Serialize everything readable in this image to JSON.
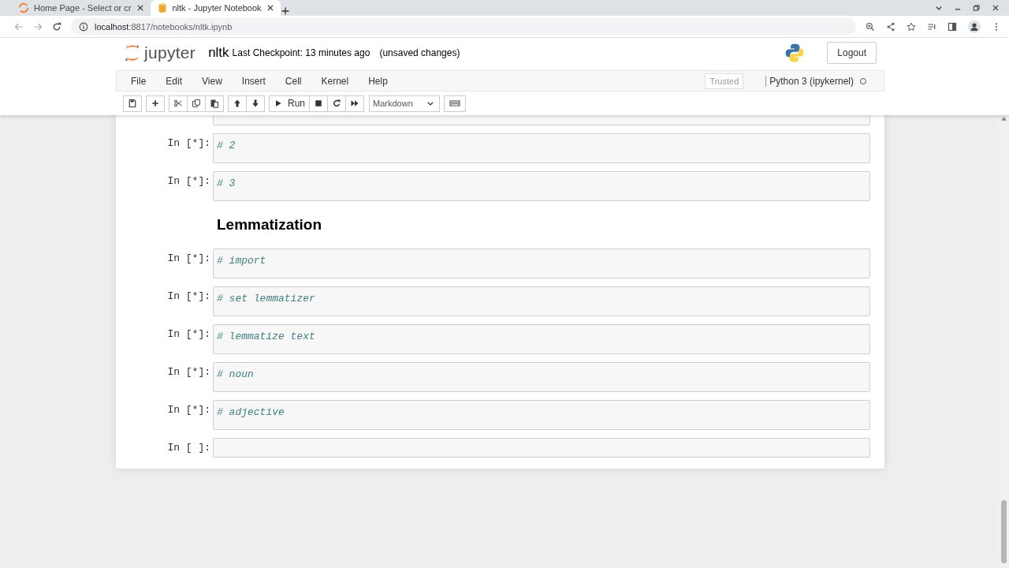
{
  "browser": {
    "tabs": [
      {
        "title": "Home Page - Select or cr",
        "selected": false
      },
      {
        "title": "nltk - Jupyter Notebook",
        "selected": true
      }
    ],
    "address": {
      "host": "localhost",
      "path": ":8817/notebooks/nltk.ipynb"
    }
  },
  "header": {
    "logo_text": "jupyter",
    "notebook_name": "nltk",
    "checkpoint": "Last Checkpoint: 13 minutes ago",
    "save_status": "(unsaved changes)",
    "logout": "Logout"
  },
  "menubar": {
    "items": [
      "File",
      "Edit",
      "View",
      "Insert",
      "Cell",
      "Kernel",
      "Help"
    ],
    "trusted": "Trusted",
    "kernel": "Python 3 (ipykernel)",
    "kernel_busy": false
  },
  "toolbar": {
    "groups": [
      [
        {
          "kind": "save"
        }
      ],
      [
        {
          "kind": "add"
        }
      ],
      [
        {
          "kind": "cut"
        },
        {
          "kind": "copy"
        },
        {
          "kind": "paste"
        }
      ],
      [
        {
          "kind": "up"
        },
        {
          "kind": "down"
        }
      ],
      [
        {
          "kind": "run",
          "label": "Run"
        },
        {
          "kind": "stop"
        },
        {
          "kind": "restart"
        },
        {
          "kind": "forward"
        }
      ],
      [
        {
          "kind": "select",
          "value": "Markdown"
        }
      ],
      [
        {
          "kind": "keyboard"
        }
      ]
    ]
  },
  "cells": [
    {
      "kind": "cut"
    },
    {
      "kind": "code",
      "prompt": "In [*]:",
      "source": "# 2"
    },
    {
      "kind": "code",
      "prompt": "In [*]:",
      "source": "# 3"
    },
    {
      "kind": "markdown",
      "heading": "Lemmatization"
    },
    {
      "kind": "code",
      "prompt": "In [*]:",
      "source": "# import"
    },
    {
      "kind": "code",
      "prompt": "In [*]:",
      "source": "# set lemmatizer"
    },
    {
      "kind": "code",
      "prompt": "In [*]:",
      "source": "# lemmatize text"
    },
    {
      "kind": "code",
      "prompt": "In [*]:",
      "source": "# noun"
    },
    {
      "kind": "code",
      "prompt": "In [*]:",
      "source": "# adjective"
    },
    {
      "kind": "empty",
      "prompt": "In [ ]:"
    }
  ]
}
